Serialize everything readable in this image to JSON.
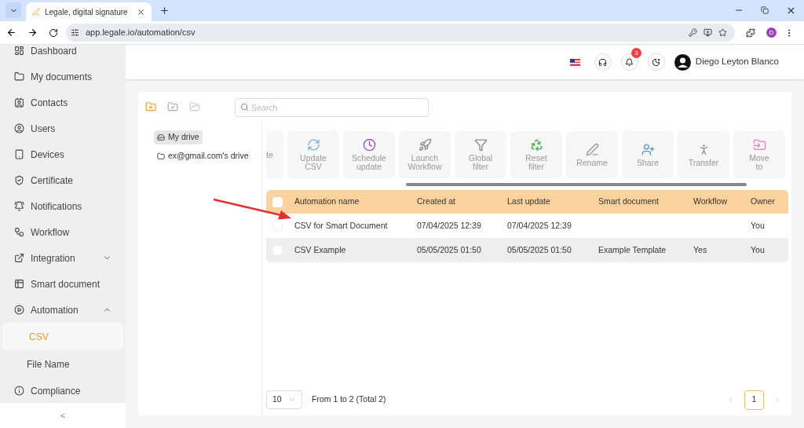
{
  "browser": {
    "tab_title": "Legale, digital signature",
    "address": "app.legale.io/automation/csv",
    "profile_initial": "D"
  },
  "header": {
    "user_name": "Diego Leyton Blanco",
    "notification_count": "3"
  },
  "sidebar": {
    "items": [
      {
        "label": "Dashboard",
        "kind": "dashboard",
        "selected": false
      },
      {
        "label": "My documents",
        "kind": "folder",
        "selected": false
      },
      {
        "label": "Contacts",
        "kind": "contacts",
        "selected": false
      },
      {
        "label": "Users",
        "kind": "users",
        "selected": false
      },
      {
        "label": "Devices",
        "kind": "devices",
        "selected": false
      },
      {
        "label": "Certificate",
        "kind": "certificate",
        "selected": false
      },
      {
        "label": "Notifications",
        "kind": "notifications",
        "selected": false
      },
      {
        "label": "Workflow",
        "kind": "workflow",
        "selected": false
      },
      {
        "label": "Integration",
        "kind": "integration",
        "selected": false,
        "expanded": false
      },
      {
        "label": "Smart document",
        "kind": "smart",
        "selected": false
      },
      {
        "label": "Automation",
        "kind": "automation",
        "selected": false,
        "expanded": true,
        "children": [
          {
            "label": "CSV",
            "selected": true
          },
          {
            "label": "File Name",
            "selected": false
          }
        ]
      },
      {
        "label": "Compliance",
        "kind": "compliance",
        "selected": false
      }
    ],
    "collapse": "<"
  },
  "tree": [
    {
      "label": "My drive",
      "kind": "drive",
      "selected": true
    },
    {
      "label": "ex@gmail.com's drive",
      "kind": "folder",
      "selected": false
    }
  ],
  "search": {
    "placeholder": "Search"
  },
  "toolbar": [
    {
      "label": "te",
      "kind": "cut"
    },
    {
      "label": "Update CSV",
      "kind": "update"
    },
    {
      "label": "Schedule update",
      "kind": "schedule"
    },
    {
      "label": "Launch Workflow",
      "kind": "launch"
    },
    {
      "label": "Global filter",
      "kind": "filter"
    },
    {
      "label": "Reset filter",
      "kind": "reset"
    },
    {
      "label": "Rename",
      "kind": "rename"
    },
    {
      "label": "Share",
      "kind": "share"
    },
    {
      "label": "Transfer",
      "kind": "transfer"
    },
    {
      "label": "Move to",
      "kind": "move"
    }
  ],
  "table": {
    "all_checked": false,
    "columns": [
      "Automation name",
      "Created at",
      "Last update",
      "Smart document",
      "Workflow",
      "Owner"
    ],
    "rows": [
      {
        "checked": false,
        "selected": false,
        "cells": [
          "CSV for Smart Document",
          "07/04/2025 12:39",
          "07/04/2025 12:39",
          "",
          "",
          "You"
        ]
      },
      {
        "checked": false,
        "selected": true,
        "cells": [
          "CSV Example",
          "05/05/2025 01:50",
          "05/05/2025 01:50",
          "Example Template",
          "Yes",
          "You"
        ]
      }
    ]
  },
  "pagination": {
    "page_size": "10",
    "summary": "From 1 to 2 (Total 2)",
    "pages": [
      {
        "label": "1",
        "selected": true
      }
    ]
  }
}
